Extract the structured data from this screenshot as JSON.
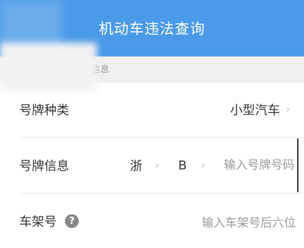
{
  "header": {
    "title": "机动车违法查询"
  },
  "section": {
    "label": "信息"
  },
  "rows": {
    "plate_type": {
      "label": "号牌种类",
      "value": "小型汽车",
      "chevron": "›"
    },
    "plate_info": {
      "label": "号牌信息",
      "province": "浙",
      "letter": "B",
      "chevron": "›",
      "placeholder": "输入号牌号码"
    },
    "frame": {
      "label": "车架号",
      "help_icon": "?",
      "placeholder": "输入车架号后六位"
    }
  },
  "colors": {
    "header_bg": "#4a9ae8",
    "section_bg": "#efefef"
  }
}
